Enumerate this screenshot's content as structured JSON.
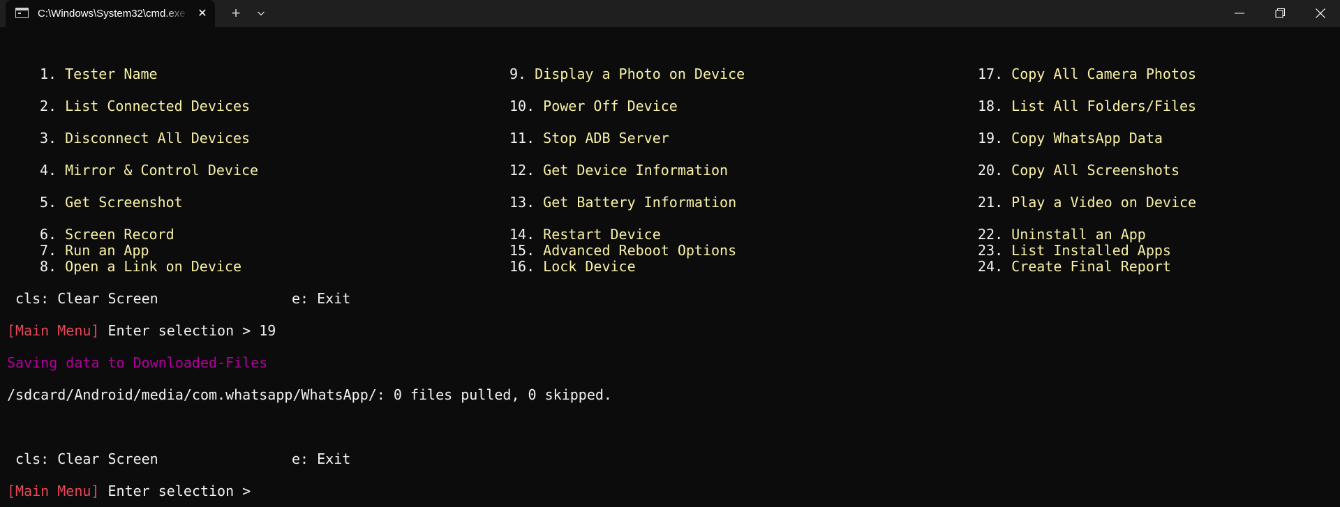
{
  "tab": {
    "title": "C:\\Windows\\System32\\cmd.exe",
    "close_glyph": "✕"
  },
  "titlebar": {
    "new_tab_glyph": "+"
  },
  "colors": {
    "background": "#0c0c0c",
    "titlebar": "#1f1f1f",
    "menu_item": "#f9f1a5",
    "prompt_tag": "#e74856",
    "saving_text": "#b4009e",
    "default_text": "#f2f2f2"
  },
  "menu": {
    "col1": [
      {
        "num": "1.",
        "label": "Tester Name"
      },
      {
        "num": "2.",
        "label": "List Connected Devices"
      },
      {
        "num": "3.",
        "label": "Disconnect All Devices"
      },
      {
        "num": "4.",
        "label": "Mirror & Control Device"
      },
      {
        "num": "5.",
        "label": "Get Screenshot"
      },
      {
        "num": "6.",
        "label": "Screen Record"
      },
      {
        "num": "7.",
        "label": "Run an App"
      },
      {
        "num": "8.",
        "label": "Open a Link on Device"
      }
    ],
    "col2": [
      {
        "num": "9.",
        "label": "Display a Photo on Device"
      },
      {
        "num": "10.",
        "label": "Power Off Device"
      },
      {
        "num": "11.",
        "label": "Stop ADB Server"
      },
      {
        "num": "12.",
        "label": "Get Device Information"
      },
      {
        "num": "13.",
        "label": "Get Battery Information"
      },
      {
        "num": "14.",
        "label": "Restart Device"
      },
      {
        "num": "15.",
        "label": "Advanced Reboot Options"
      },
      {
        "num": "16.",
        "label": "Lock Device"
      }
    ],
    "col3": [
      {
        "num": "17.",
        "label": "Copy All Camera Photos"
      },
      {
        "num": "18.",
        "label": "List All Folders/Files"
      },
      {
        "num": "19.",
        "label": "Copy WhatsApp Data"
      },
      {
        "num": "20.",
        "label": "Copy All Screenshots"
      },
      {
        "num": "21.",
        "label": "Play a Video on Device"
      },
      {
        "num": "22.",
        "label": "Uninstall an App"
      },
      {
        "num": "23.",
        "label": "List Installed Apps"
      },
      {
        "num": "24.",
        "label": "Create Final Report"
      }
    ]
  },
  "shortcuts": {
    "clear": "cls: Clear Screen",
    "exit": "e: Exit"
  },
  "prompt": {
    "tag": "[Main Menu]",
    "text": " Enter selection > ",
    "first_input": "19",
    "second_input": ""
  },
  "output": {
    "saving": "Saving data to Downloaded-Files",
    "result": "/sdcard/Android/media/com.whatsapp/WhatsApp/: 0 files pulled, 0 skipped."
  }
}
